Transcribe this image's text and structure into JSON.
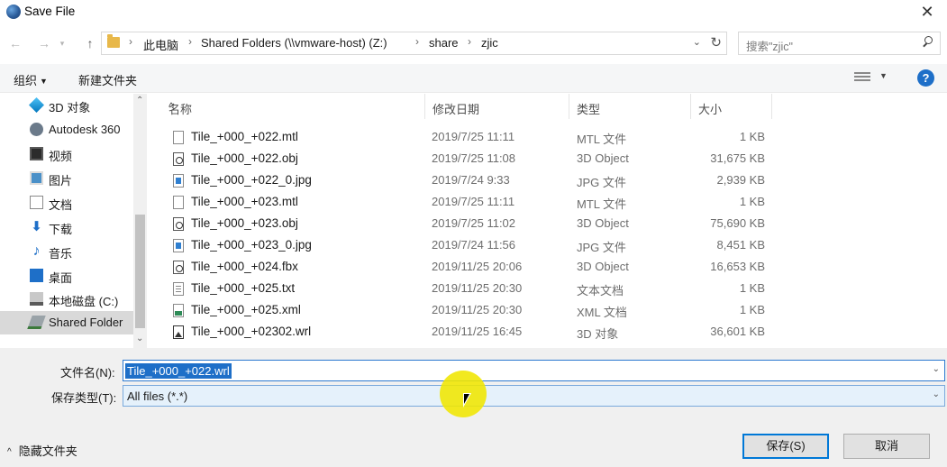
{
  "window": {
    "title": "Save File",
    "close_glyph": "✕"
  },
  "address": {
    "crumbs": [
      "此电脑",
      "Shared Folders (\\\\vmware-host) (Z:)",
      "share",
      "zjic"
    ],
    "search_placeholder": "搜索\"zjic\""
  },
  "toolbar": {
    "organize_label": "组织",
    "new_folder_label": "新建文件夹",
    "help_glyph": "?"
  },
  "sidebar": {
    "items": [
      {
        "label": "3D 对象",
        "icon": "3d-objects-icon"
      },
      {
        "label": "Autodesk 360",
        "icon": "cloud-icon"
      },
      {
        "label": "视频",
        "icon": "video-icon"
      },
      {
        "label": "图片",
        "icon": "pictures-icon"
      },
      {
        "label": "文档",
        "icon": "documents-icon"
      },
      {
        "label": "下载",
        "icon": "download-icon"
      },
      {
        "label": "音乐",
        "icon": "music-icon"
      },
      {
        "label": "桌面",
        "icon": "desktop-icon"
      },
      {
        "label": "本地磁盘 (C:)",
        "icon": "drive-icon"
      },
      {
        "label": "Shared Folder",
        "icon": "network-drive-icon",
        "selected": true
      }
    ]
  },
  "columns": {
    "name": "名称",
    "date": "修改日期",
    "type": "类型",
    "size": "大小"
  },
  "files": [
    {
      "name": "Tile_+000_+022.mtl",
      "date": "2019/7/25 11:11",
      "type": "MTL 文件",
      "size": "1 KB",
      "icon": "text-file-icon"
    },
    {
      "name": "Tile_+000_+022.obj",
      "date": "2019/7/25 11:08",
      "type": "3D Object",
      "size": "31,675 KB",
      "icon": "3d-object-file-icon"
    },
    {
      "name": "Tile_+000_+022_0.jpg",
      "date": "2019/7/24 9:33",
      "type": "JPG 文件",
      "size": "2,939 KB",
      "icon": "image-file-icon"
    },
    {
      "name": "Tile_+000_+023.mtl",
      "date": "2019/7/25 11:11",
      "type": "MTL 文件",
      "size": "1 KB",
      "icon": "text-file-icon"
    },
    {
      "name": "Tile_+000_+023.obj",
      "date": "2019/7/25 11:02",
      "type": "3D Object",
      "size": "75,690 KB",
      "icon": "3d-object-file-icon"
    },
    {
      "name": "Tile_+000_+023_0.jpg",
      "date": "2019/7/24 11:56",
      "type": "JPG 文件",
      "size": "8,451 KB",
      "icon": "image-file-icon"
    },
    {
      "name": "Tile_+000_+024.fbx",
      "date": "2019/11/25 20:06",
      "type": "3D Object",
      "size": "16,653 KB",
      "icon": "3d-object-file-icon"
    },
    {
      "name": "Tile_+000_+025.txt",
      "date": "2019/11/25 20:30",
      "type": "文本文档",
      "size": "1 KB",
      "icon": "txt-file-icon"
    },
    {
      "name": "Tile_+000_+025.xml",
      "date": "2019/11/25 20:30",
      "type": "XML 文档",
      "size": "1 KB",
      "icon": "xml-file-icon"
    },
    {
      "name": "Tile_+000_+02302.wrl",
      "date": "2019/11/25 16:45",
      "type": "3D 对象",
      "size": "36,601 KB",
      "icon": "wrl-file-icon"
    }
  ],
  "form": {
    "filename_label": "文件名(N):",
    "filename_value": "Tile_+000_+022.wrl",
    "filetype_label": "保存类型(T):",
    "filetype_value": "All files (*.*)",
    "hide_folders_label": "隐藏文件夹",
    "save_label": "保存(S)",
    "cancel_label": "取消"
  }
}
